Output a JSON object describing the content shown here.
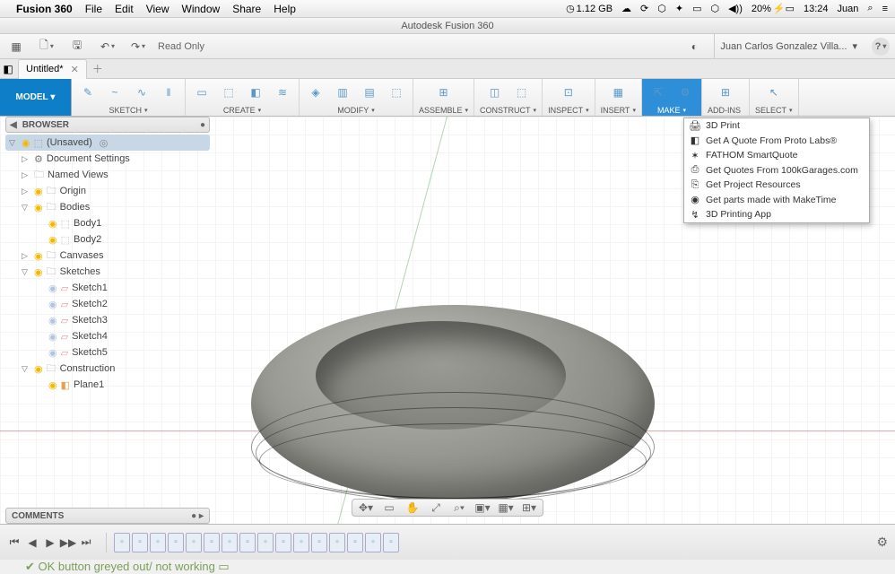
{
  "mac_menu": {
    "app_name": "Fusion 360",
    "items": [
      "File",
      "Edit",
      "View",
      "Window",
      "Share",
      "Help"
    ],
    "right": {
      "mem": "1.12 GB",
      "battery": "20%",
      "time": "13:24",
      "user": "Juan"
    }
  },
  "window_title": "Autodesk Fusion 360",
  "toolbar": {
    "read_only": "Read Only",
    "user_display": "Juan Carlos Gonzalez Villa..."
  },
  "tabs": {
    "active_title": "Untitled*"
  },
  "ribbon": {
    "model_label": "MODEL",
    "groups": [
      {
        "id": "sketch",
        "label": "SKETCH",
        "caret": true,
        "icons": [
          "✎",
          "~",
          "∿",
          "‖"
        ]
      },
      {
        "id": "create",
        "label": "CREATE",
        "caret": true,
        "icons": [
          "▭",
          "⬚",
          "◧",
          "≋"
        ]
      },
      {
        "id": "modify",
        "label": "MODIFY",
        "caret": true,
        "icons": [
          "◈",
          "▥",
          "▤",
          "⬚"
        ]
      },
      {
        "id": "assemble",
        "label": "ASSEMBLE",
        "caret": true,
        "icons": [
          "⊞"
        ]
      },
      {
        "id": "construct",
        "label": "CONSTRUCT",
        "caret": true,
        "icons": [
          "◫",
          "⬚"
        ]
      },
      {
        "id": "inspect",
        "label": "INSPECT",
        "caret": true,
        "icons": [
          "⊡"
        ]
      },
      {
        "id": "insert",
        "label": "INSERT",
        "caret": true,
        "icons": [
          "▦"
        ]
      },
      {
        "id": "make",
        "label": "MAKE",
        "caret": true,
        "highlighted": true,
        "icons": [
          "⇱",
          "⚙"
        ]
      },
      {
        "id": "addins",
        "label": "ADD-INS",
        "caret": false,
        "icons": [
          "⊞"
        ]
      },
      {
        "id": "select",
        "label": "SELECT",
        "caret": true,
        "icons": [
          "↖"
        ]
      }
    ]
  },
  "make_menu": [
    {
      "icon": "🖨",
      "label": "3D Print"
    },
    {
      "icon": "◧",
      "label": "Get A Quote From Proto Labs®"
    },
    {
      "icon": "✶",
      "label": "FATHOM SmartQuote"
    },
    {
      "icon": "⎙",
      "label": "Get Quotes From 100kGarages.com"
    },
    {
      "icon": "⎘",
      "label": "Get Project Resources"
    },
    {
      "icon": "◉",
      "label": "Get parts made with MakeTime"
    },
    {
      "icon": "↯",
      "label": "3D Printing App"
    }
  ],
  "browser": {
    "title": "BROWSER",
    "root": "(Unsaved)",
    "nodes": [
      {
        "indent": 1,
        "toggle": "▷",
        "bulb": false,
        "gear": true,
        "label": "Document Settings"
      },
      {
        "indent": 1,
        "toggle": "▷",
        "folder": true,
        "label": "Named Views"
      },
      {
        "indent": 1,
        "toggle": "▷",
        "bulb": "on",
        "folder": true,
        "label": "Origin"
      },
      {
        "indent": 1,
        "toggle": "▽",
        "bulb": "on",
        "folder": true,
        "label": "Bodies"
      },
      {
        "indent": 2,
        "bulb": "on",
        "body": true,
        "label": "Body1"
      },
      {
        "indent": 2,
        "bulb": "on",
        "body": true,
        "label": "Body2"
      },
      {
        "indent": 1,
        "toggle": "▷",
        "bulb": "on",
        "folder": true,
        "label": "Canvases"
      },
      {
        "indent": 1,
        "toggle": "▽",
        "bulb": "on",
        "folder": true,
        "label": "Sketches"
      },
      {
        "indent": 2,
        "bulb": "off",
        "sketch": true,
        "label": "Sketch1"
      },
      {
        "indent": 2,
        "bulb": "off",
        "sketch": true,
        "label": "Sketch2"
      },
      {
        "indent": 2,
        "bulb": "off",
        "sketch": true,
        "label": "Sketch3"
      },
      {
        "indent": 2,
        "bulb": "off",
        "sketch": true,
        "label": "Sketch4"
      },
      {
        "indent": 2,
        "bulb": "off",
        "sketch": true,
        "label": "Sketch5"
      },
      {
        "indent": 1,
        "toggle": "▽",
        "bulb": "on",
        "folder": true,
        "label": "Construction"
      },
      {
        "indent": 2,
        "bulb": "on",
        "plane": true,
        "label": "Plane1"
      }
    ]
  },
  "comments": {
    "title": "COMMENTS"
  },
  "timeline": {
    "item_count": 16
  },
  "cutoff_text": "OK button greyed out/ not working"
}
